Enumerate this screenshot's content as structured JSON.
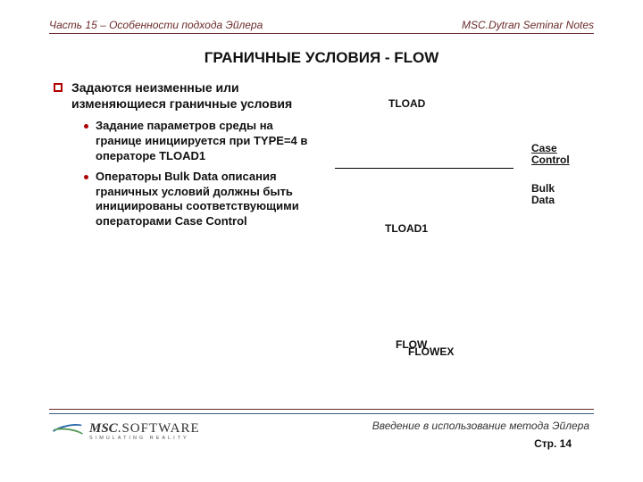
{
  "header": {
    "left": "Часть 15 – Особенности подхода Эйлера",
    "right": "MSC.Dytran Seminar Notes"
  },
  "title": "ГРАНИЧНЫЕ УСЛОВИЯ - FLOW",
  "content": {
    "main": "Задаются неизменные или изменяющиеся граничные условия",
    "subs": [
      "Задание параметров среды на границе инициируется при TYPE=4 в операторе TLOAD1",
      "Операторы Bulk Data описания граничных условий должны быть инициированы соответствующими операторами Case Control"
    ]
  },
  "diagram": {
    "tload": "TLOAD",
    "case_control": "Case Control",
    "bulk_data": "Bulk Data",
    "tload1": "TLOAD1",
    "flow": "FLOW",
    "flowex": "FLOWEX"
  },
  "footer": {
    "subtitle": "Введение в использование метода Эйлера",
    "page": "Стр. 14"
  },
  "logo": {
    "brand_prefix": "MSC",
    "brand_suffix": "SOFTWARE",
    "tagline": "SIMULATING REALITY"
  }
}
